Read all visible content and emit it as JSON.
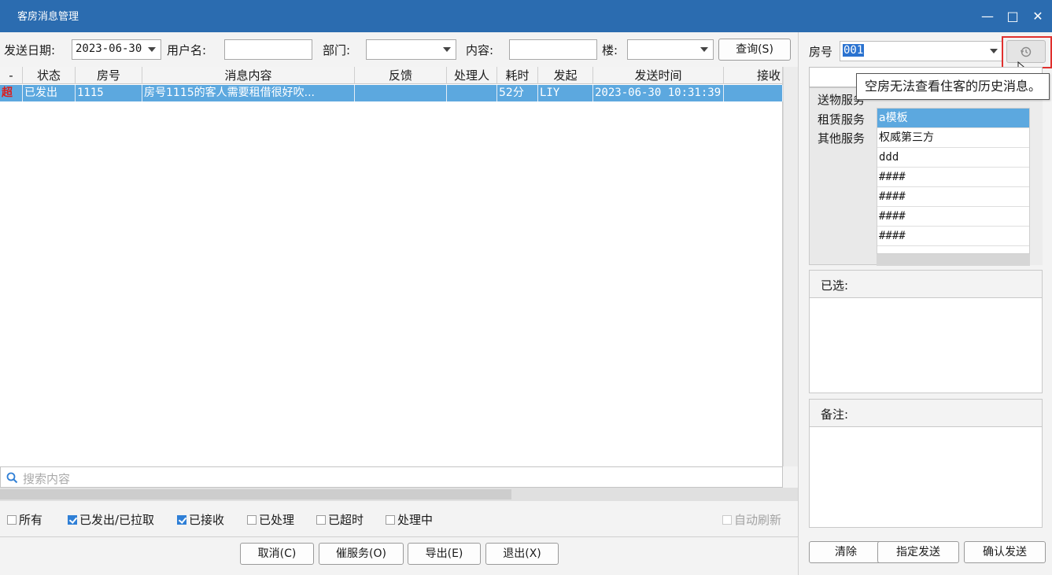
{
  "window": {
    "title": "客房消息管理",
    "controls": {
      "minimize": "—",
      "maximize": "□",
      "close": "✕"
    }
  },
  "filters": {
    "send_date_label": "发送日期:",
    "send_date_value": "2023-06-30",
    "username_label": "用户名:",
    "username_value": "",
    "dept_label": "部门:",
    "dept_value": "",
    "content_label": "内容:",
    "content_value": "",
    "building_label": "楼:",
    "building_value": "",
    "query_button": "查询(S)"
  },
  "grid": {
    "columns": [
      "-",
      "状态",
      "房号",
      "消息内容",
      "反馈",
      "处理人",
      "耗时",
      "发起",
      "发送时间",
      "接收"
    ],
    "rows": [
      {
        "flag": "超",
        "status": "已发出",
        "room": "1115",
        "content": "房号1115的客人需要租借很好吹...",
        "feedback": "",
        "handler": "",
        "duration": "52分",
        "initiator": "LIY",
        "send_time": "2023-06-30 10:31:39",
        "receive": ""
      }
    ],
    "search_placeholder": "搜索内容"
  },
  "checkboxes": [
    {
      "label": "所有",
      "checked": false
    },
    {
      "label": "已发出/已拉取",
      "checked": true
    },
    {
      "label": "已接收",
      "checked": true
    },
    {
      "label": "已处理",
      "checked": false
    },
    {
      "label": "已超时",
      "checked": false
    },
    {
      "label": "处理中",
      "checked": false
    }
  ],
  "auto_refresh": {
    "label": "自动刷新",
    "checked": false,
    "disabled": true
  },
  "bottom_buttons": {
    "cancel": "取消(C)",
    "urge": "催服务(O)",
    "export": "导出(E)",
    "exit": "退出(X)"
  },
  "right_panel": {
    "room_label": "房号",
    "room_value": "001",
    "history_icon": "history-icon",
    "tooltip": "空房无法查看住客的历史消息。",
    "categories": [
      "送物服务",
      "租赁服务",
      "其他服务"
    ],
    "templates": [
      "a模板",
      "权威第三方",
      "ddd",
      "####",
      "####",
      "####",
      "####"
    ],
    "selected_label": "已选:",
    "remark_label": "备注:",
    "buttons": {
      "clear": "清除",
      "send_to": "指定发送",
      "confirm_send": "确认发送"
    }
  },
  "colors": {
    "titlebar": "#2b6cb0",
    "row_selected": "#5ca8df",
    "flag_red": "#d92020",
    "highlight_red": "#e0302e"
  }
}
